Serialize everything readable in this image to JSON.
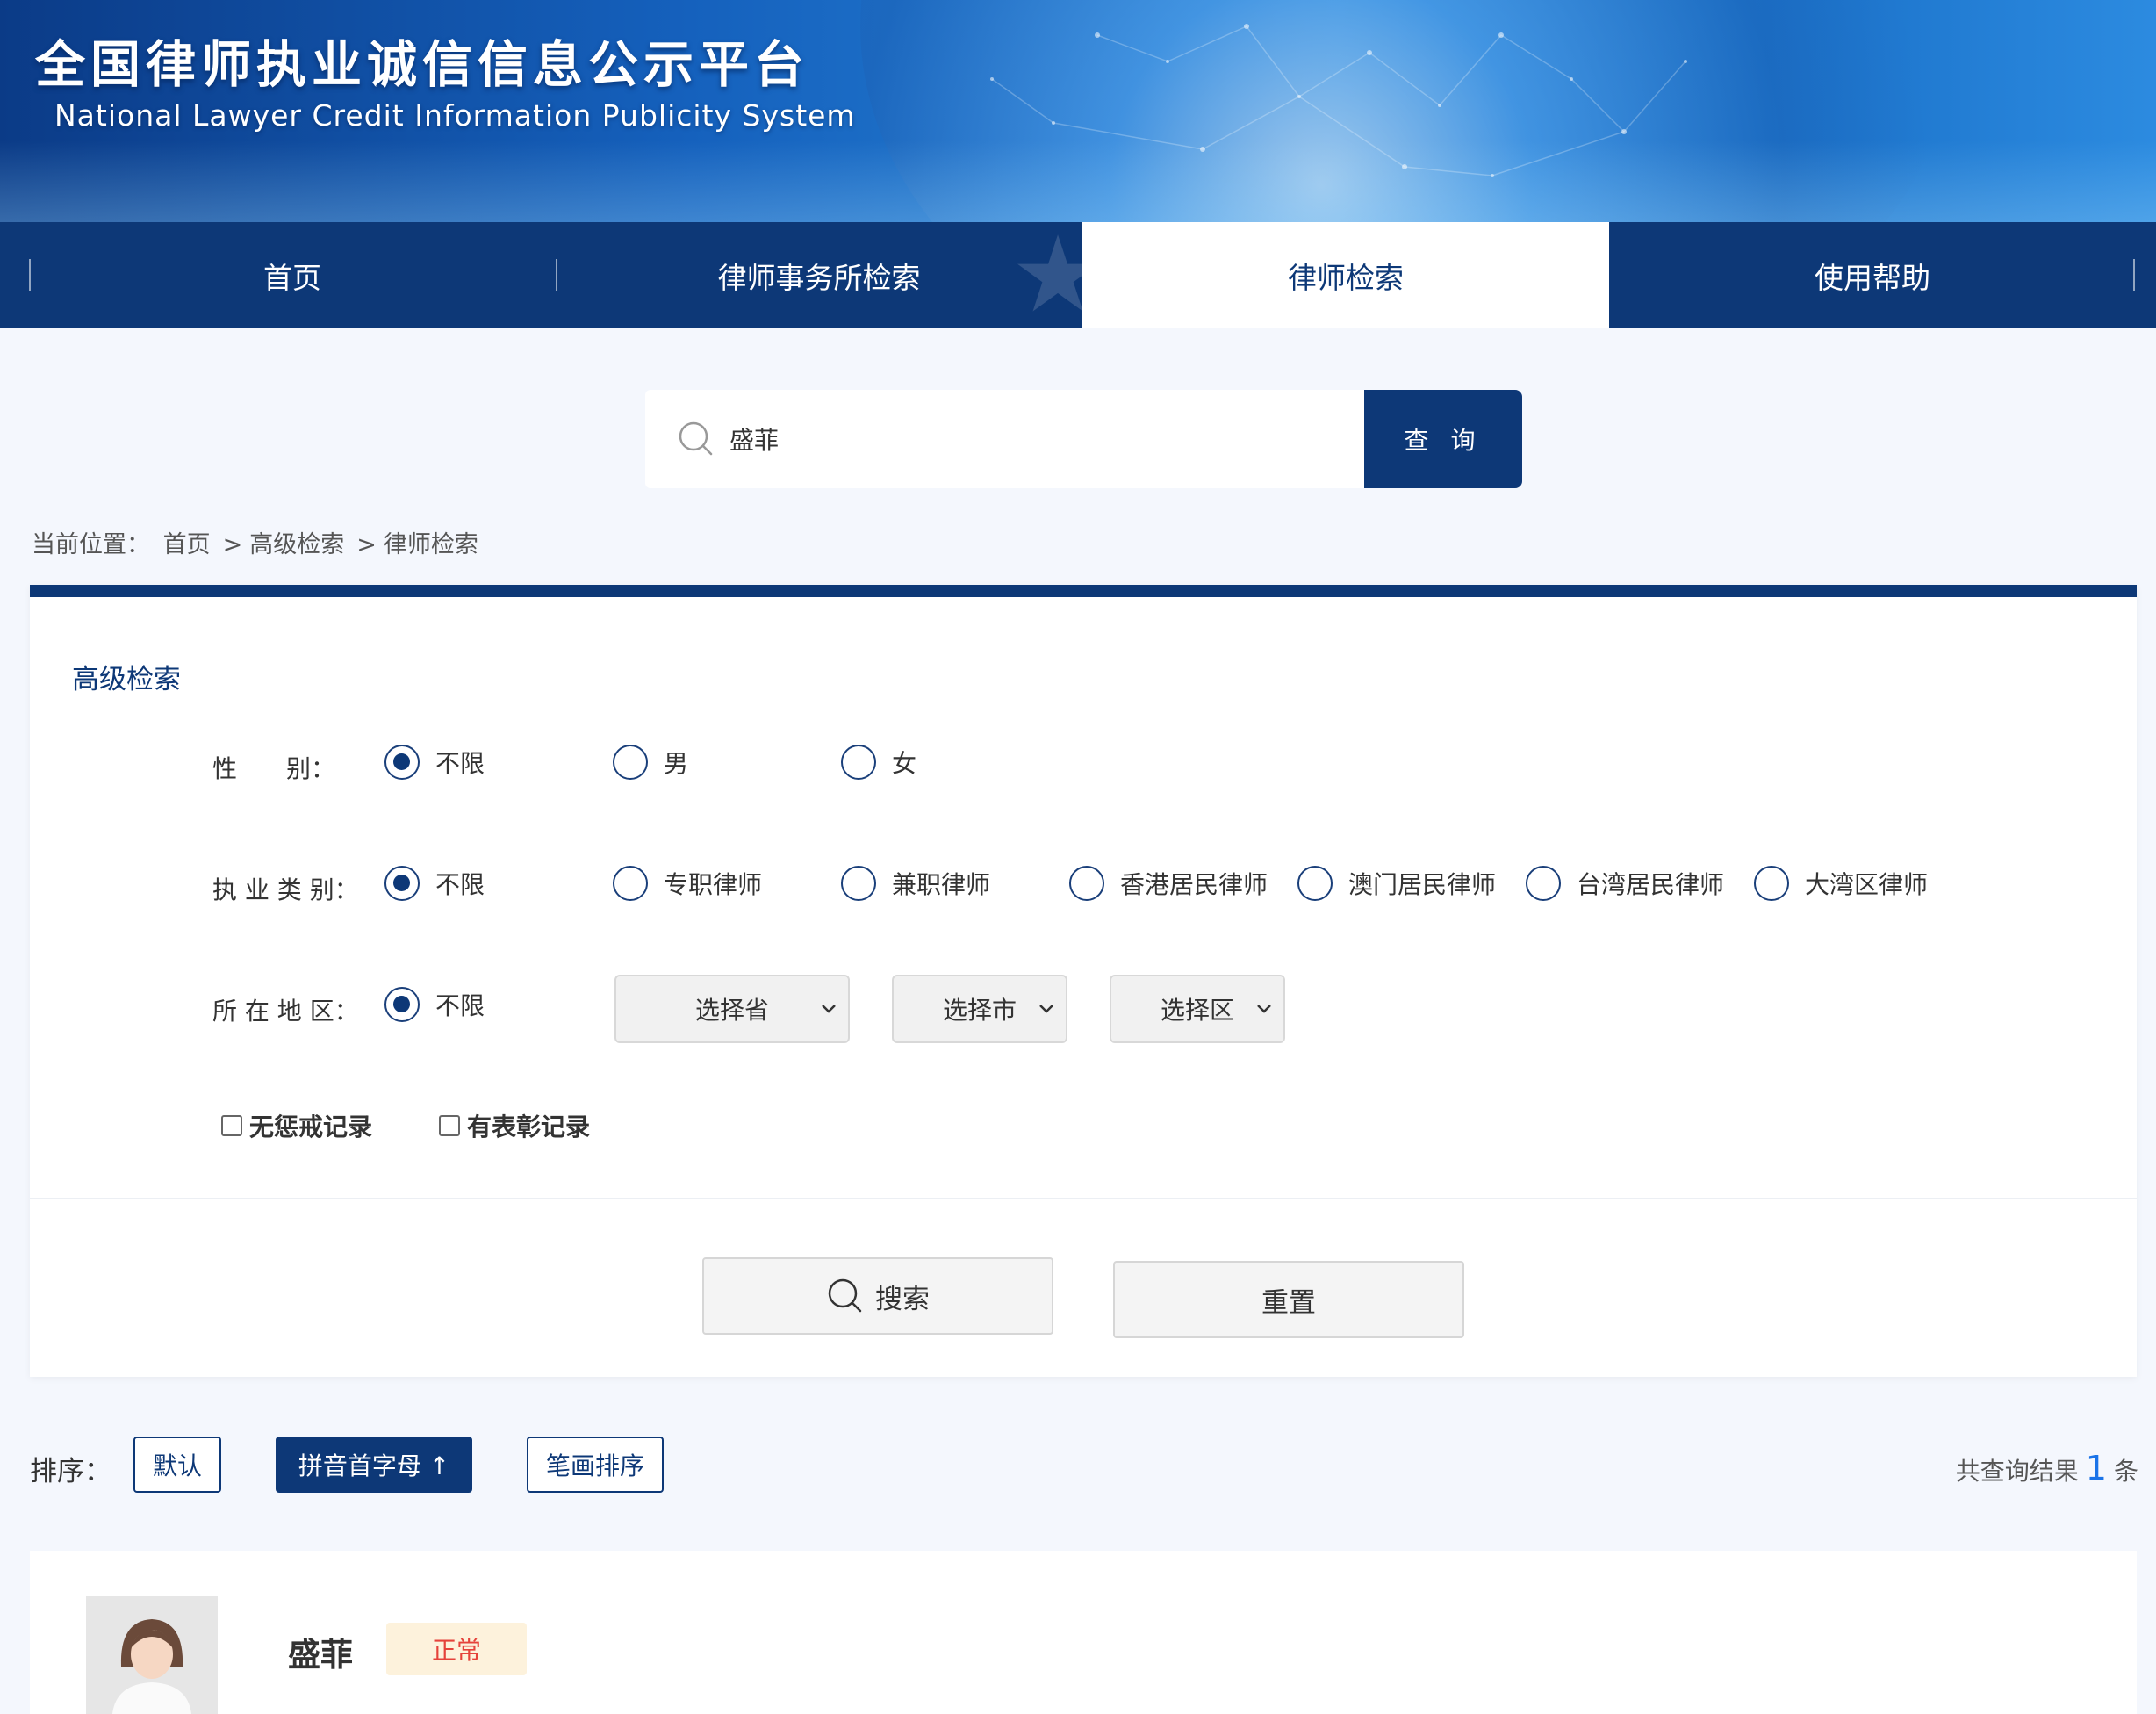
{
  "header": {
    "title_cn": "全国律师执业诚信信息公示平台",
    "title_en": "National Lawyer Credit Information Publicity System"
  },
  "nav": {
    "items": [
      {
        "label": "首页"
      },
      {
        "label": "律师事务所检索"
      },
      {
        "label": "律师检索",
        "active": true
      },
      {
        "label": "使用帮助"
      }
    ]
  },
  "search": {
    "value": "盛菲",
    "button_label": "查 询"
  },
  "breadcrumb": {
    "prefix": "当前位置：",
    "items": [
      "首页",
      "高级检索",
      "律师检索"
    ],
    "separator": ">"
  },
  "advanced": {
    "title": "高级检索",
    "gender": {
      "label": "性　　别：",
      "options": [
        "不限",
        "男",
        "女"
      ],
      "selected": "不限"
    },
    "practice_type": {
      "label": "执 业 类 别：",
      "options": [
        "不限",
        "专职律师",
        "兼职律师",
        "香港居民律师",
        "澳门居民律师",
        "台湾居民律师",
        "大湾区律师"
      ],
      "selected": "不限"
    },
    "region": {
      "label": "所 在 地 区：",
      "option_any": "不限",
      "selected": "不限",
      "province": "选择省",
      "city": "选择市",
      "district": "选择区"
    },
    "checks": {
      "no_discipline": "无惩戒记录",
      "has_commendation": "有表彰记录"
    },
    "search_button": "搜索",
    "reset_button": "重置"
  },
  "sort": {
    "label": "排序：",
    "options": [
      {
        "label": "默认",
        "active": false
      },
      {
        "label": "拼音首字母 ↑",
        "active": true
      },
      {
        "label": "笔画排序",
        "active": false
      }
    ],
    "result_prefix": "共查询结果",
    "result_count": "1",
    "result_suffix": "条"
  },
  "results": [
    {
      "name": "盛菲",
      "status": "正常"
    }
  ],
  "colors": {
    "primary": "#0d3877",
    "page_bg": "#f4f7fd",
    "badge_bg": "#fdf2dc",
    "badge_text": "#e5433b",
    "count_blue": "#1a73e8"
  }
}
